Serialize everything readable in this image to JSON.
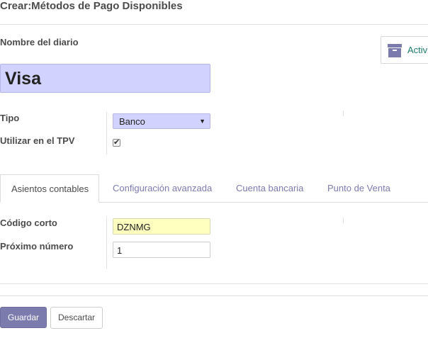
{
  "header": {
    "title": "Crear:Métodos de Pago Disponibles"
  },
  "form": {
    "name_label": "Nombre del diario",
    "name_value": "Visa",
    "archive_button_label": "Activ",
    "type_label": "Tipo",
    "type_value": "Banco",
    "pos_label": "Utilizar en el TPV",
    "pos_checked": true
  },
  "tabs": [
    {
      "label": "Asientos contables",
      "active": true
    },
    {
      "label": "Configuración avanzada",
      "active": false
    },
    {
      "label": "Cuenta bancaria",
      "active": false
    },
    {
      "label": "Punto de Venta",
      "active": false
    }
  ],
  "journal": {
    "short_code_label": "Código corto",
    "short_code_value": "DZNMG",
    "next_number_label": "Próximo número",
    "next_number_value": "1"
  },
  "footer": {
    "save_label": "Guardar",
    "discard_label": "Descartar"
  },
  "colors": {
    "primary": "#7c7bad",
    "required_field": "#d2d2ff",
    "modified_field": "#ffffc0",
    "archive_text": "#1d7b6f"
  },
  "icons": {
    "archive": "archive-box-icon",
    "checkmark": "check-icon",
    "dropdown": "caret-down-icon"
  }
}
